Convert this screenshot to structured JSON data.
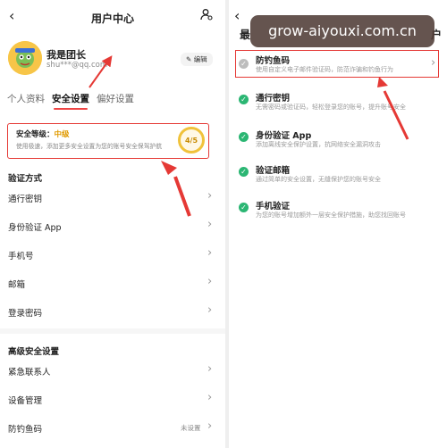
{
  "left_screen": {
    "header": {
      "back_icon": "chevron-left-icon",
      "title": "用户中心",
      "settings_icon": "user-settings-icon"
    },
    "profile": {
      "name": "我是团长",
      "email": "shu***@qq.com",
      "edit_label": "编辑",
      "edit_icon": "pencil-icon"
    },
    "tabs": [
      {
        "label": "个人资料",
        "active": false
      },
      {
        "label": "安全设置",
        "active": true
      },
      {
        "label": "偏好设置",
        "active": false
      }
    ],
    "security_card": {
      "title": "安全等级：",
      "level": "中级",
      "desc": "使用极速，添加更多安全设置为您的账号安全保驾护航",
      "score": "4/5",
      "score_fraction": 0.8
    },
    "verify_section": {
      "title": "验证方式",
      "items": [
        {
          "label": "通行密钥"
        },
        {
          "label": "身份验证 App"
        },
        {
          "label": "手机号"
        },
        {
          "label": "邮箱"
        },
        {
          "label": "登录密码"
        }
      ]
    },
    "advanced_section": {
      "title": "高级安全设置",
      "items": [
        {
          "label": "紧急联系人",
          "status": ""
        },
        {
          "label": "设备管理",
          "status": ""
        },
        {
          "label": "防钓鱼码",
          "status": "未设置"
        }
      ]
    }
  },
  "right_screen": {
    "header": {
      "back_icon": "chevron-left-icon",
      "title_left": "最",
      "title_right": "户"
    },
    "watermark": "grow-aiyouxi.com.cn",
    "items": [
      {
        "title": "防钓鱼码",
        "desc": "使用自定义电子邮件验证码，防范诈骗和钓鱼行为",
        "done": false,
        "arrow": true
      },
      {
        "title": "通行密钥",
        "desc": "无需密码或验证码，轻松登录您的账号，提升账号安全",
        "done": true,
        "arrow": false
      },
      {
        "title": "身份验证 App",
        "desc": "添加离线安全保护设置，抗网络安全漏洞攻击",
        "done": true,
        "arrow": false
      },
      {
        "title": "验证邮箱",
        "desc": "通过简单的安全设置，无缝保护您的账号安全",
        "done": true,
        "arrow": false
      },
      {
        "title": "手机验证",
        "desc": "为您的账号增加额外一层安全保护措施，助您找回账号",
        "done": true,
        "arrow": false
      }
    ]
  },
  "colors": {
    "highlight_red": "#e53935",
    "accent_green": "#2bb673",
    "level_orange": "#e09a00",
    "tab_underline": "#e44"
  }
}
